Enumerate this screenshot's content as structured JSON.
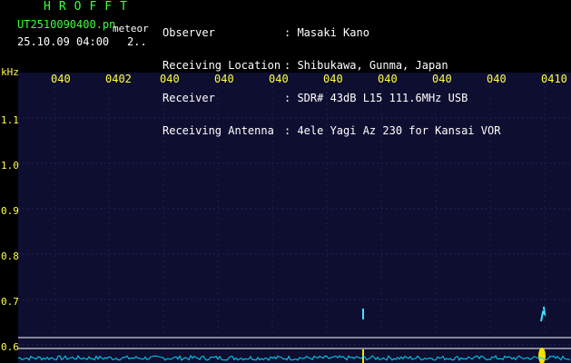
{
  "header": {
    "title": "HROFFT",
    "filename": "UT2510090400.pn",
    "meteor_label": "meteor",
    "datetime": "25.10.09 04:00",
    "counter": "2..",
    "info": [
      {
        "key": "Observer",
        "value": ": Masaki Kano"
      },
      {
        "key": "Receiving Location",
        "value": ": Shibukawa, Gunma, Japan"
      },
      {
        "key": "Receiver",
        "value": ": SDR# 43dB L15 111.6MHz USB"
      },
      {
        "key": "Receiving Antenna",
        "value": ": 4ele Yagi Az 230 for Kansai VOR"
      }
    ]
  },
  "axis": {
    "y_unit": "kHz",
    "y_labels": [
      "1.1",
      "1.0",
      "0.9",
      "0.8",
      "0.7",
      "0.6"
    ],
    "x_labels": [
      "040",
      "0402",
      "040",
      "040",
      "040",
      "040",
      "040",
      "040",
      "040",
      "0410"
    ]
  },
  "colors": {
    "background": "#000000",
    "plot_bg": "#0e0e30",
    "accent_green": "#3cff3c",
    "label_yellow": "#ffff40",
    "signal_cyan": "#00e0ff"
  }
}
